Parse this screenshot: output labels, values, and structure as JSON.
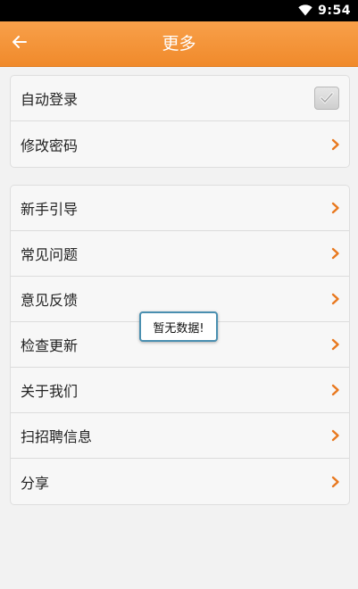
{
  "status_bar": {
    "time": "9:54",
    "wifi_icon": "wifi-icon"
  },
  "header": {
    "title": "更多",
    "back_icon": "arrow-left-icon"
  },
  "group1": {
    "items": [
      {
        "label": "自动登录",
        "control": "checkbox",
        "checked": true
      },
      {
        "label": "修改密码",
        "control": "chevron"
      }
    ]
  },
  "group2": {
    "items": [
      {
        "label": "新手引导"
      },
      {
        "label": "常见问题"
      },
      {
        "label": "意见反馈"
      },
      {
        "label": "检查更新"
      },
      {
        "label": "关于我们"
      },
      {
        "label": "扫招聘信息"
      },
      {
        "label": "分享"
      }
    ]
  },
  "toast": {
    "text": "暂无数据!"
  },
  "colors": {
    "accent": "#f08a2b",
    "chevron": "#e8781e",
    "toast_border": "#4a8fb0"
  }
}
